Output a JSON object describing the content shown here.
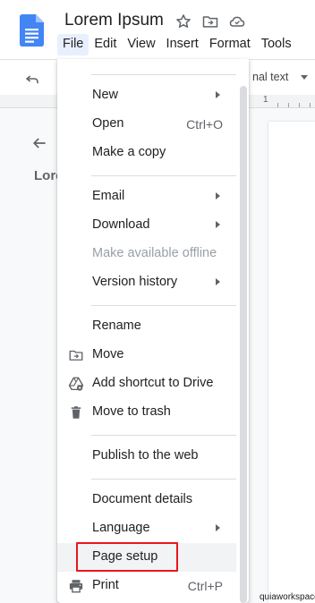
{
  "document": {
    "title": "Lorem Ipsum",
    "outline_title": "Lore"
  },
  "menubar": {
    "items": [
      "File",
      "Edit",
      "View",
      "Insert",
      "Format",
      "Tools"
    ],
    "active": "File"
  },
  "toolbar": {
    "style_label": "nal text"
  },
  "ruler": {
    "label": "1"
  },
  "file_menu": {
    "new": {
      "label": "New"
    },
    "open": {
      "label": "Open",
      "shortcut": "Ctrl+O"
    },
    "make_copy": {
      "label": "Make a copy"
    },
    "email": {
      "label": "Email"
    },
    "download": {
      "label": "Download"
    },
    "offline": {
      "label": "Make available offline"
    },
    "version_history": {
      "label": "Version history"
    },
    "rename": {
      "label": "Rename"
    },
    "move": {
      "label": "Move"
    },
    "add_shortcut": {
      "label": "Add shortcut to Drive"
    },
    "trash": {
      "label": "Move to trash"
    },
    "publish": {
      "label": "Publish to the web"
    },
    "details": {
      "label": "Document details"
    },
    "language": {
      "label": "Language"
    },
    "page_setup": {
      "label": "Page setup"
    },
    "print": {
      "label": "Print",
      "shortcut": "Ctrl+P"
    }
  },
  "watermark": "quiaworkspace",
  "icons": {
    "logo": "docs-logo-icon",
    "star": "star-icon",
    "move": "folder-move-icon",
    "cloud": "cloud-status-icon",
    "undo": "undo-icon",
    "back": "arrow-back-icon",
    "add_shortcut": "drive-shortcut-icon",
    "trash": "trash-icon",
    "print": "printer-icon"
  },
  "colors": {
    "docs_blue": "#4285f4",
    "highlight_box": "#e8161e",
    "menu_active": "#e8f0fe"
  }
}
